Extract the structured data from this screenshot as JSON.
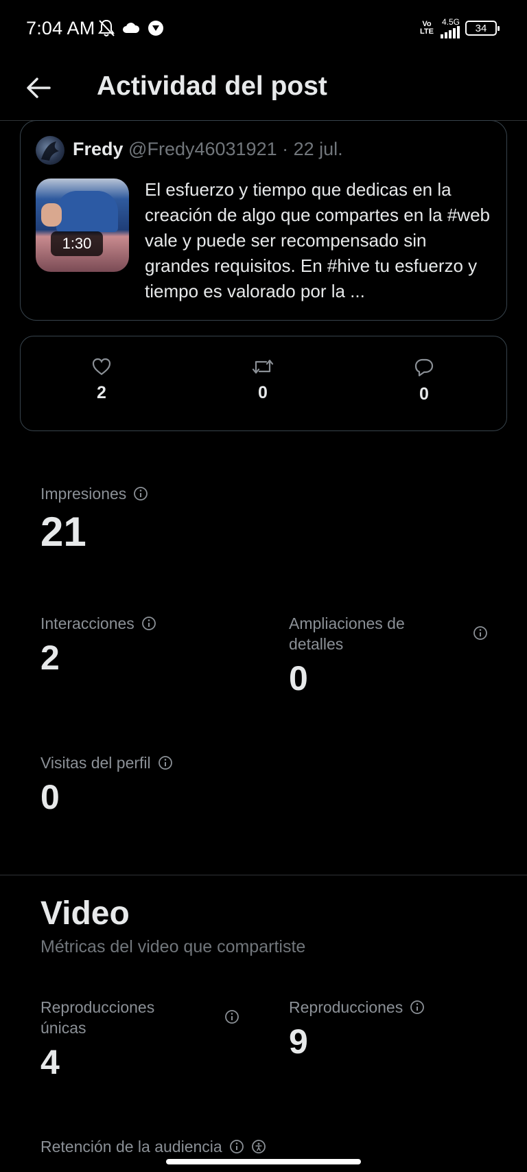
{
  "status_bar": {
    "time": "7:04 AM",
    "network_top": "Vo",
    "network_bottom": "LTE",
    "signal": "4.5G",
    "battery": "34"
  },
  "header": {
    "title": "Actividad del post"
  },
  "tweet": {
    "author_name": "Fredy",
    "author_handle": "@Fredy46031921",
    "date": "· 22 jul.",
    "video_duration": "1:30",
    "text": "El esfuerzo y tiempo que dedicas en la creación de algo que compartes en la #web vale y puede ser recompensado sin grandes requisitos. En #hive tu esfuerzo y tiempo es valorado por la ..."
  },
  "engagement": {
    "likes": "2",
    "reposts": "0",
    "replies": "0"
  },
  "metrics": {
    "impressions_label": "Impresiones",
    "impressions_value": "21",
    "interactions_label": "Interacciones",
    "interactions_value": "2",
    "detail_expands_label": "Ampliaciones de detalles",
    "detail_expands_value": "0",
    "profile_visits_label": "Visitas del perfil",
    "profile_visits_value": "0"
  },
  "video": {
    "title": "Video",
    "subtitle": "Métricas del video que compartiste",
    "unique_plays_label": "Reproducciones únicas",
    "unique_plays_value": "4",
    "plays_label": "Reproducciones",
    "plays_value": "9",
    "retention_label": "Retención de la audiencia"
  },
  "colors": {
    "background": "#000000",
    "text_primary": "#e7e9ea",
    "text_secondary": "#71767b",
    "border": "#38444d"
  }
}
